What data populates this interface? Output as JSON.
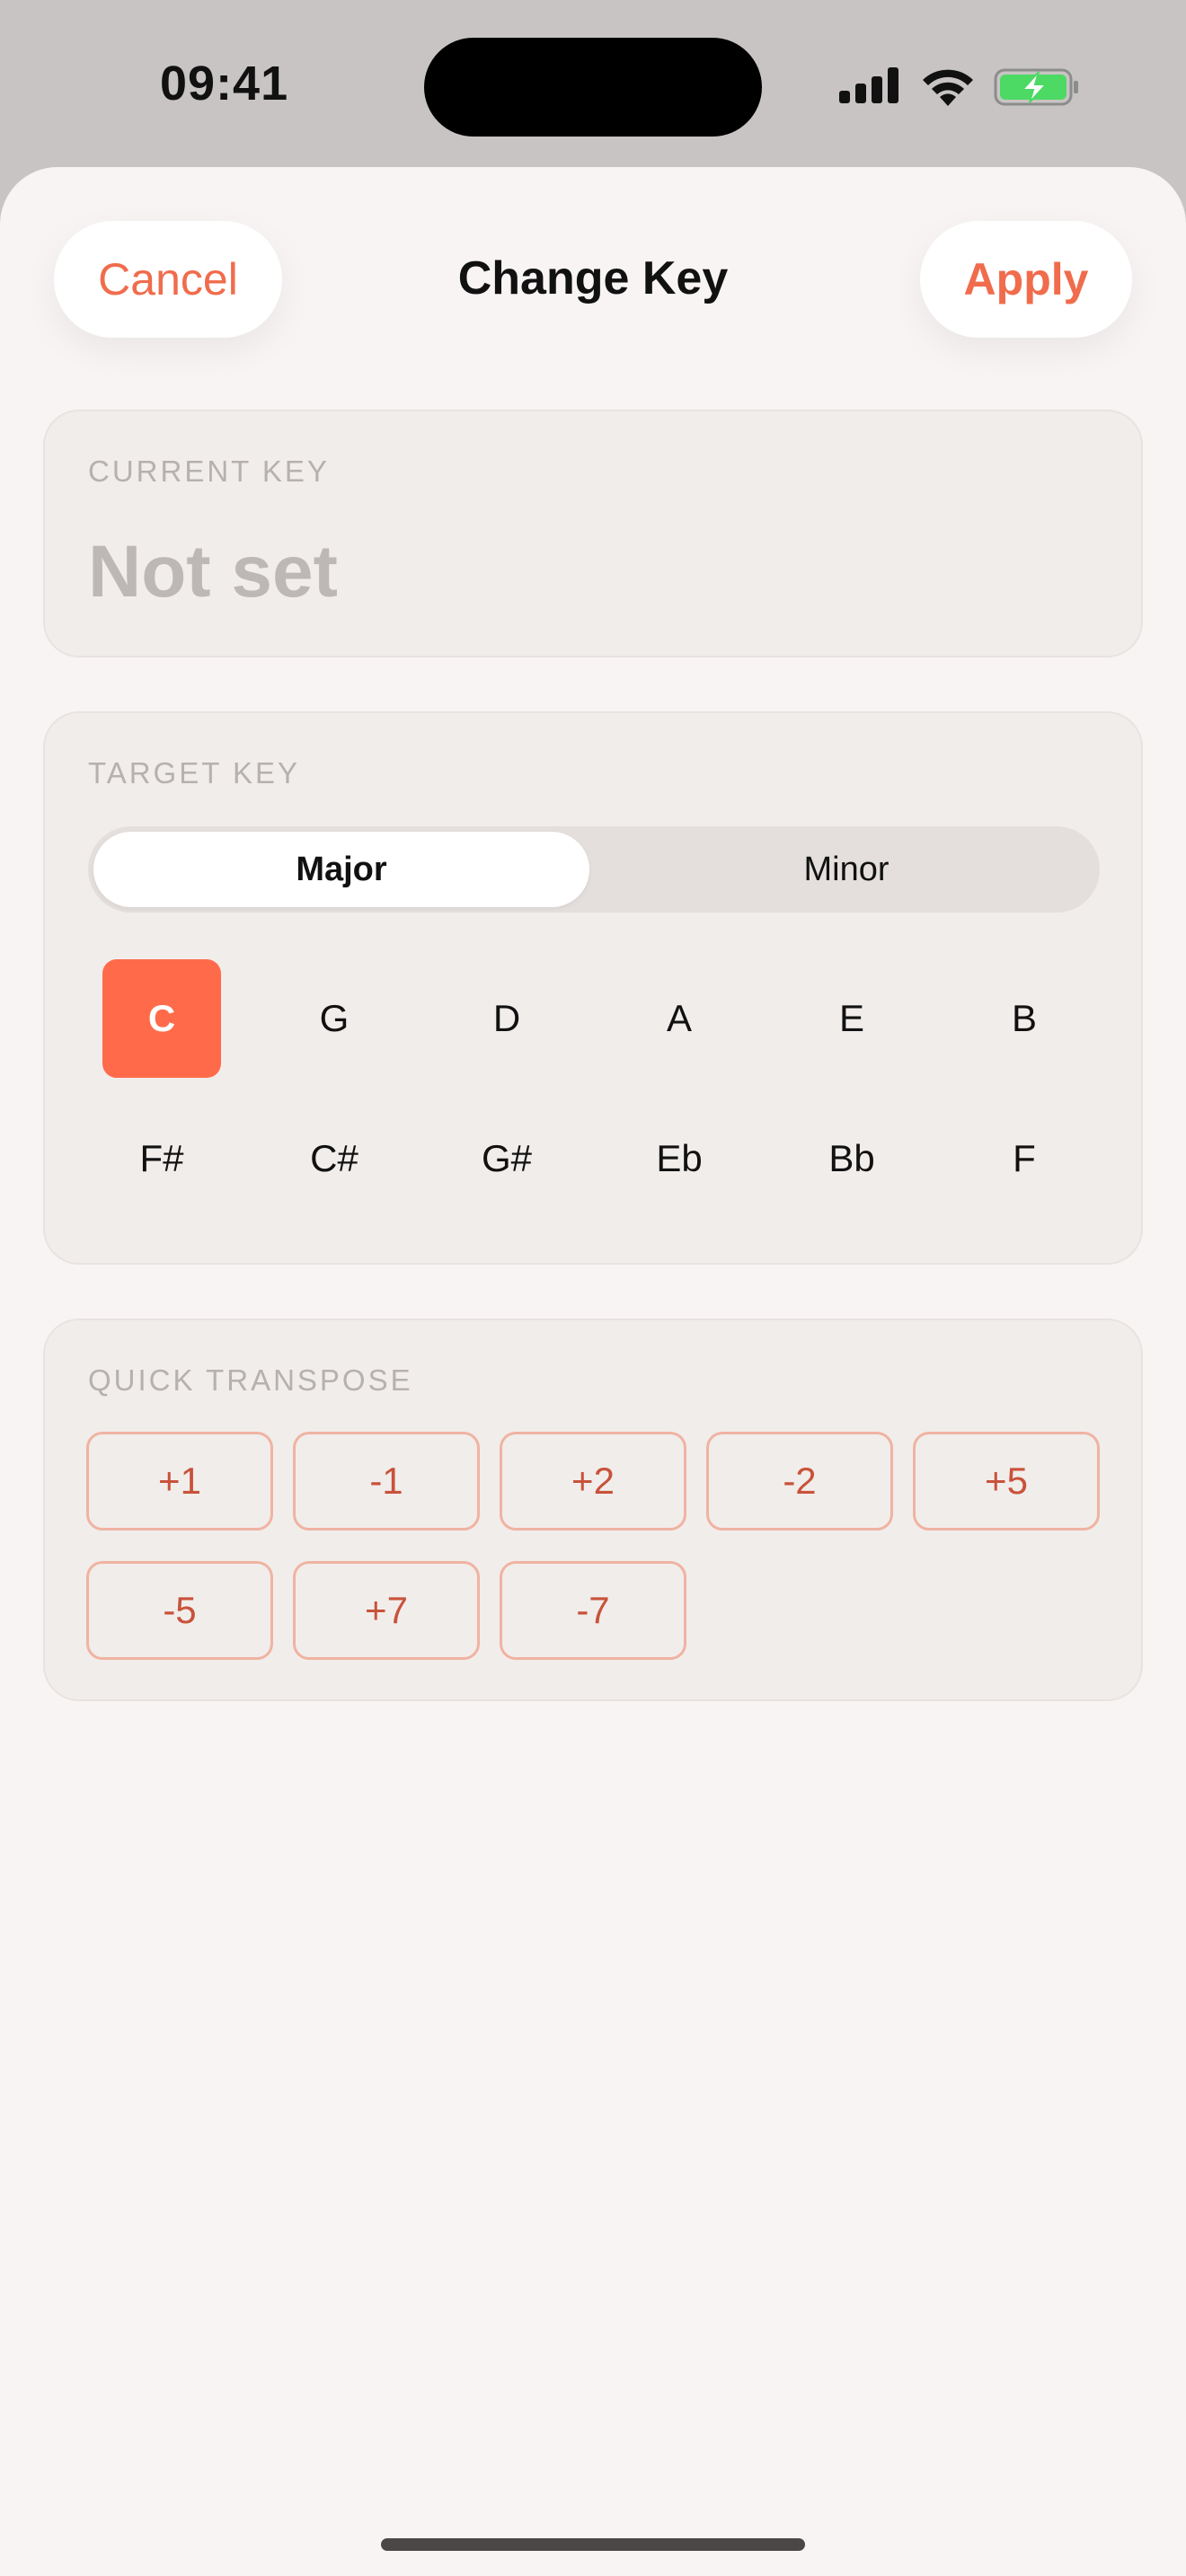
{
  "status": {
    "time": "09:41"
  },
  "nav": {
    "cancel_label": "Cancel",
    "title": "Change Key",
    "apply_label": "Apply"
  },
  "current_key": {
    "label": "CURRENT KEY",
    "value": "Not set"
  },
  "target_key": {
    "label": "TARGET KEY",
    "modes": [
      "Major",
      "Minor"
    ],
    "selected_mode": "Major",
    "keys": [
      "C",
      "G",
      "D",
      "A",
      "E",
      "B",
      "F#",
      "C#",
      "G#",
      "Eb",
      "Bb",
      "F"
    ],
    "selected_key": "C"
  },
  "quick_transpose": {
    "label": "QUICK TRANSPOSE",
    "buttons": [
      "+1",
      "-1",
      "+2",
      "-2",
      "+5",
      "-5",
      "+7",
      "-7"
    ]
  },
  "colors": {
    "accent": "#ff6b4a",
    "accent_text": "#f06c4c",
    "battery_green": "#4cd964"
  }
}
